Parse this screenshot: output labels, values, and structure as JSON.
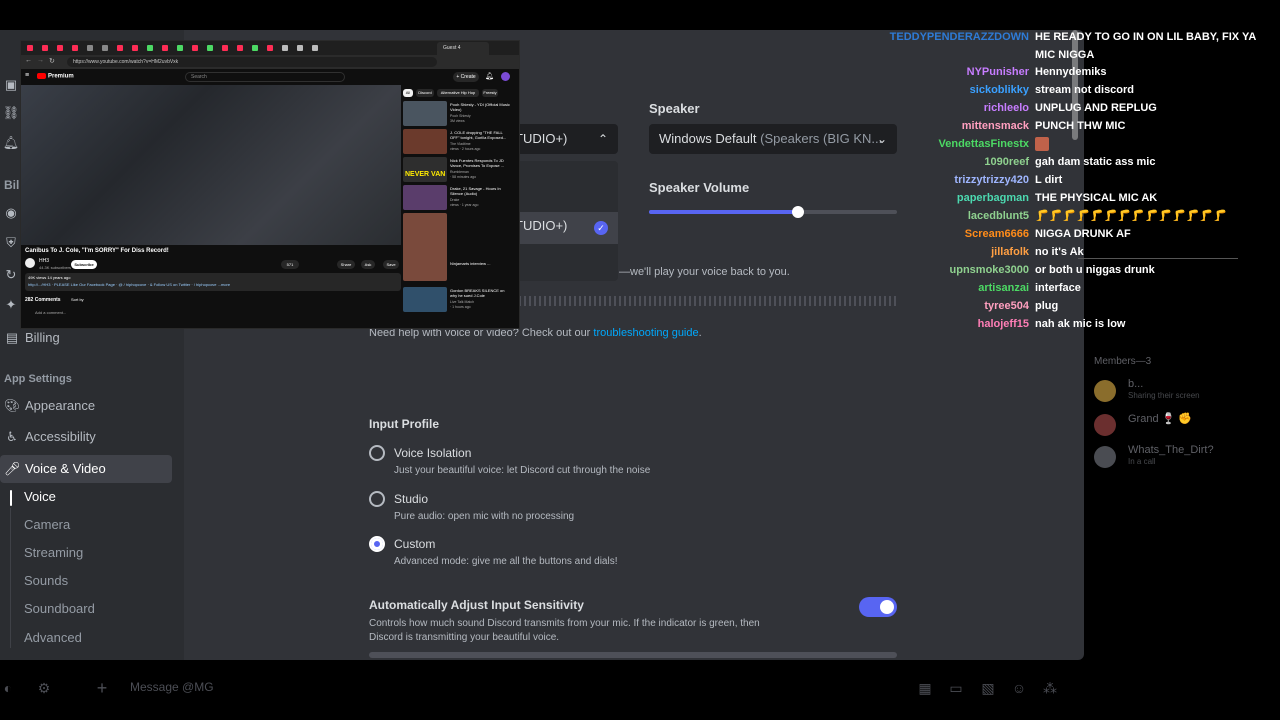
{
  "sidebar": {
    "billing_heading": "Bill",
    "billing_item": "Billing",
    "app_settings_heading": "App Settings",
    "items": [
      {
        "label": "Appearance",
        "icon": "palette-icon"
      },
      {
        "label": "Accessibility",
        "icon": "accessibility-icon"
      },
      {
        "label": "Voice & Video",
        "icon": "microphone-icon"
      }
    ],
    "sub_items": [
      "Voice",
      "Camera",
      "Streaming",
      "Sounds",
      "Soundboard",
      "Advanced"
    ]
  },
  "voice": {
    "input_device_partial": "TUDIO+)",
    "menu_selected_partial": "TUDIO+)",
    "speaker_label": "Speaker",
    "speaker_value": "Windows Default",
    "speaker_value_muted": "(Speakers (BIG KN...",
    "speaker_volume_label": "Speaker Volume",
    "speaker_volume_value": 0.6,
    "mic_test_partial": "—we'll play your voice back to you.",
    "help_text": "Need help with voice or video? Check out our",
    "help_link": "troubleshooting guide",
    "help_period": ".",
    "input_profile_label": "Input Profile",
    "profiles": [
      {
        "title": "Voice Isolation",
        "desc": "Just your beautiful voice: let Discord cut through the noise",
        "selected": false
      },
      {
        "title": "Studio",
        "desc": "Pure audio: open mic with no processing",
        "selected": false
      },
      {
        "title": "Custom",
        "desc": "Advanced mode: give me all the buttons and dials!",
        "selected": true
      }
    ],
    "auto_sensitivity_label": "Automatically Adjust Input Sensitivity",
    "auto_sensitivity_desc1": "Controls how much sound Discord transmits from your mic. If the indicator is green, then",
    "auto_sensitivity_desc2": "Discord is transmitting your beautiful voice.",
    "auto_sensitivity_on": true
  },
  "members": {
    "heading": "Members—3",
    "list": [
      {
        "name": "b...",
        "status": "Sharing their screen"
      },
      {
        "name": "Grand 🍷 ✊",
        "status": ""
      },
      {
        "name": "Whats_The_Dirt?",
        "status": "In a call"
      }
    ]
  },
  "bottombar": {
    "message_placeholder": "Message @MG"
  },
  "chat": [
    {
      "user": "TEDDYPENDERAZZDOWN",
      "color": "#2e7bd6",
      "msg": "HE READY TO GO IN ON LIL BABY, FIX YA MIC NIGGA"
    },
    {
      "user": "NYPunisher",
      "color": "#c77dff",
      "msg": "Hennydemiks"
    },
    {
      "user": "sickoblikky",
      "color": "#3aa0ff",
      "msg": "stream not discord"
    },
    {
      "user": "richleelo",
      "color": "#c77dff",
      "msg": "UNPLUG AND REPLUG"
    },
    {
      "user": "mittensmack",
      "color": "#ff9fbf",
      "msg": "PUNCH THW MIC"
    },
    {
      "user": "VendettasFinestx",
      "color": "#4cd964",
      "msg": ""
    },
    {
      "user": "1090reef",
      "color": "#8fd18f",
      "msg": "gah dam static ass mic"
    },
    {
      "user": "trizzytrizzy420",
      "color": "#9fb6ff",
      "msg": "L dirt"
    },
    {
      "user": "paperbagman",
      "color": "#4cd9b0",
      "msg": "THE PHYSICAL MIC AK"
    },
    {
      "user": "lacedblunt5",
      "color": "#8fd18f",
      "msg": "🦵🦵🦵🦵🦵🦵🦵🦵🦵🦵🦵🦵🦵🦵"
    },
    {
      "user": "Scream6666",
      "color": "#ff8c1a",
      "msg": "NIGGA DRUNK AF"
    },
    {
      "user": "jillafolk",
      "color": "#ff9f43",
      "msg": "no it's Ak"
    },
    {
      "user": "upnsmoke3000",
      "color": "#8fd18f",
      "msg": "or both u niggas drunk"
    },
    {
      "user": "artisanzai",
      "color": "#4cd964",
      "msg": "interface"
    },
    {
      "user": "tyree504",
      "color": "#ff9fbf",
      "msg": "plug"
    },
    {
      "user": "halojeff15",
      "color": "#ff7eb6",
      "msg": "nah ak mic is low"
    }
  ],
  "browser": {
    "active_tab": "Guest 4",
    "url": "https://www.youtube.com/watch?v=HM2uvbVxk",
    "logo": "Premium",
    "search_placeholder": "Search",
    "create_label": "+ Create",
    "video_title": "Canibus To J. Cole, \"I'm SORRY\" For Diss Record!",
    "channel": "HH3",
    "subscribers": "44.3K subscribers",
    "subscribe_label": "Subscribe",
    "actions": [
      "571",
      "Share",
      "Ask",
      "Save"
    ],
    "desc_line1": "49K views  14 years ago",
    "desc_line2": "http://.../HH3 · PLEASE Like Our Facebook Page · @ / hiphopcove · & Follow US on Twitter · / hiphopcove ...more",
    "comments_label": "282 Comments",
    "sort_label": "Sort by",
    "add_comment_placeholder": "Add a comment...",
    "chips": [
      "All",
      "Discord",
      "Alternative Hip Hop",
      "Freesty"
    ],
    "recommendations": [
      {
        "title": "Pooh Shiesty - YDI (Official Music Video)",
        "channel": "Pooh Shiesty",
        "meta": "3M views",
        "color": "#4a5560",
        "label": ""
      },
      {
        "title": "J. COLE dropping \"THE FALL OFF\" tonight, Gorilla Exposed...",
        "channel": "The Vladtime",
        "meta": "views · 2 hours ago",
        "color": "#6b3a2c",
        "label": ""
      },
      {
        "title": "Nick Fuentes Responds To JD Vance, Promises To Expose ...",
        "channel": "Rumbleman",
        "meta": "· 58 minutes ago",
        "color": "#2e2e2e",
        "label": "NEVER VAN"
      },
      {
        "title": "Drake, 21 Savage - Hours In Silence (Audio)",
        "channel": "Drake",
        "meta": "views · 1 year ago",
        "color": "#5a3d6b",
        "label": ""
      },
      {
        "title": "Ninjamarts interview ...",
        "channel": "",
        "meta": "",
        "color": "#7a4a3c",
        "label": ""
      },
      {
        "title": "Gordon BREAKS SILENCE on why he sued J.Cole",
        "channel": "Live Talk Match",
        "meta": "· 1 hours ago",
        "color": "#30506b",
        "label": ""
      }
    ]
  }
}
